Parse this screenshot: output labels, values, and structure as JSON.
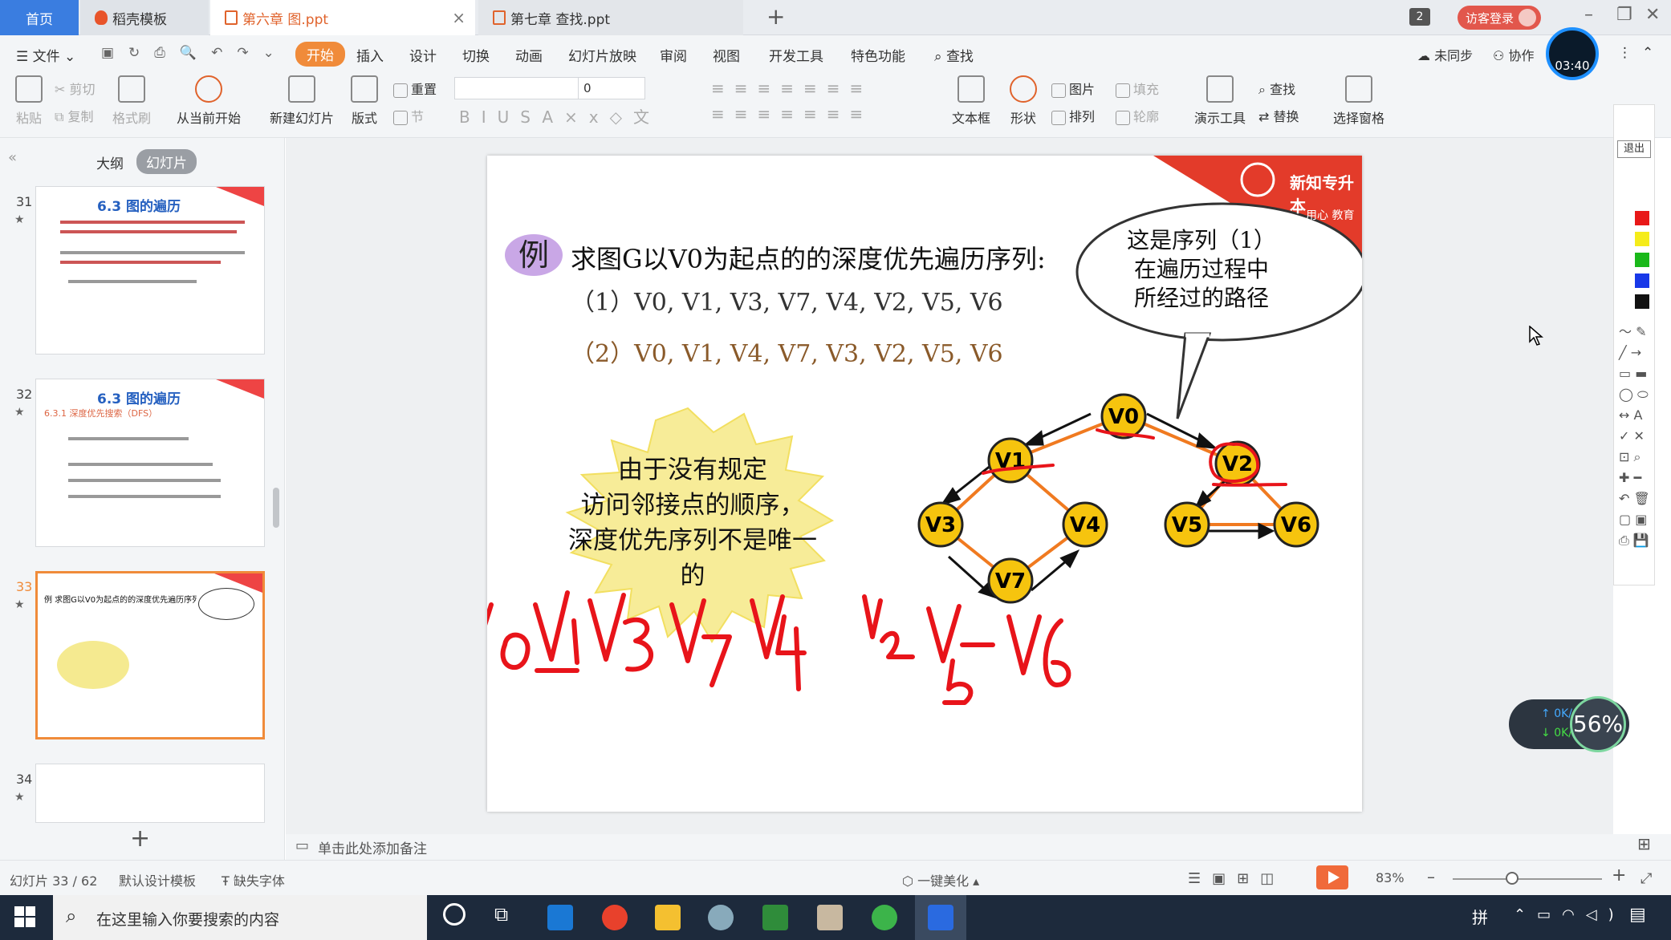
{
  "titlebar": {
    "tabs": [
      {
        "label": "首页"
      },
      {
        "label": "稻壳模板"
      },
      {
        "label": "第六章 图.ppt"
      },
      {
        "label": "第七章 查找.ppt"
      }
    ],
    "window_count": "2",
    "guest_login": "访客登录"
  },
  "menubar": {
    "file": "文件",
    "items": [
      "开始",
      "插入",
      "设计",
      "切换",
      "动画",
      "幻灯片放映",
      "审阅",
      "视图",
      "开发工具",
      "特色功能"
    ],
    "search": "查找",
    "unsynced": "未同步",
    "collab": "协作"
  },
  "ribbon": {
    "paste": "粘贴",
    "cut": "剪切",
    "copy": "复制",
    "format_painter": "格式刷",
    "from_current": "从当前开始",
    "new_slide": "新建幻灯片",
    "layout": "版式",
    "reset": "重置",
    "section": "节",
    "font_size": "0",
    "textbox": "文本框",
    "shape": "形状",
    "picture": "图片",
    "fill": "填充",
    "arrange": "排列",
    "outline": "轮廓",
    "presentation_tools": "演示工具",
    "find": "查找",
    "replace": "替换",
    "selection_pane": "选择窗格"
  },
  "left_panel": {
    "outline_tab": "大纲",
    "slides_tab": "幻灯片",
    "thumbnails": [
      {
        "number": "31",
        "title": "6.3 图的遍历"
      },
      {
        "number": "32",
        "title": "6.3 图的遍历",
        "subtitle": "6.3.1 深度优先搜索（DFS）"
      },
      {
        "number": "33",
        "title": "例 求图G以V0为起点的的深度优先遍历序列"
      },
      {
        "number": "34",
        "title": ""
      }
    ],
    "add_slide": "+"
  },
  "slide": {
    "badge": "例",
    "title": "求图G以V0为起点的的深度优先遍历序列:",
    "sequence_1": "（1）V0, V1, V3, V7, V4, V2, V5, V6",
    "sequence_2": "（2）V0, V1, V4, V7, V3, V2, V5, V6",
    "burst_lines": [
      "由于没有规定",
      "访问邻接点的顺序，",
      "深度优先序列不是唯一的"
    ],
    "bubble_lines": [
      "这是序列（1）",
      "在遍历过程中",
      "所经过的路径"
    ],
    "brand": "新知专升本",
    "brand_sub": "用心 教育",
    "nodes": [
      "V0",
      "V1",
      "V2",
      "V3",
      "V4",
      "V5",
      "V6",
      "V7"
    ],
    "handwriting": "V0 V1 V3 V7 V4 V2 V5 V6"
  },
  "notes": {
    "placeholder": "单击此处添加备注"
  },
  "statusbar": {
    "slide_counter": "幻灯片 33 / 62",
    "template": "默认设计模板",
    "missing_font": "缺失字体",
    "beautify": "一键美化",
    "zoom": "83%"
  },
  "right_tools": {
    "exit": "退出"
  },
  "overlay": {
    "timer": "03:40",
    "upload": "0K/s",
    "download": "0K/s",
    "cpu": "56%"
  },
  "taskbar": {
    "search_placeholder": "在这里输入你要搜索的内容",
    "ime": "拼"
  },
  "colors": {
    "accent": "#f08b3a",
    "tab_active": "#3a7de0",
    "ink": "#e8141a",
    "node_fill": "#f6c40e",
    "edge_orange": "#f07a20",
    "taskbar": "#1d2a3c"
  }
}
